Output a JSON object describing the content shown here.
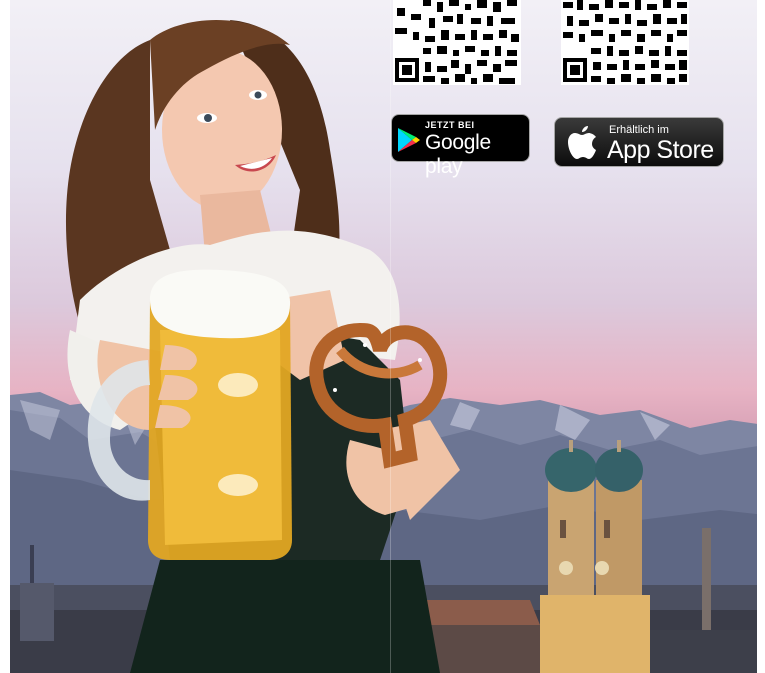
{
  "downloads": {
    "google_play": {
      "small": "JETZT BEI",
      "big": "Google play",
      "icon": "google-play-icon"
    },
    "app_store": {
      "small": "Erhältlich im",
      "big": "App Store",
      "icon": "apple-icon"
    }
  },
  "colors": {
    "sky_top": "#f2f0f6",
    "sky_pink": "#e7b3c4",
    "mountains": "#6f7895",
    "city": "#2e3446",
    "badge_bg": "#000000"
  }
}
